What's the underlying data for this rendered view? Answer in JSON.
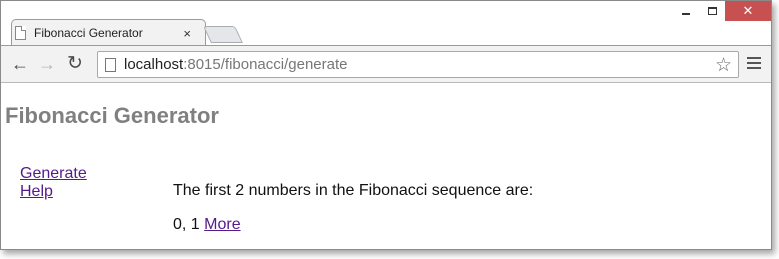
{
  "browser": {
    "tab_title": "Fibonacci Generator",
    "tab_close": "×",
    "url_host": "localhost",
    "url_rest": ":8015/fibonacci/generate",
    "close_glyph": "✕"
  },
  "page": {
    "title": "Fibonacci Generator",
    "nav": {
      "generate": "Generate",
      "help": "Help"
    },
    "intro": "The first 2 numbers in the Fibonacci sequence are:",
    "numbers": "0, 1",
    "more_link": "More"
  },
  "icons": {
    "back": "arrow-left-icon",
    "forward": "arrow-right-icon",
    "reload": "reload-icon",
    "star": "star-icon",
    "menu": "hamburger-menu-icon"
  },
  "colors": {
    "title": "#808080",
    "link": "#551a8b",
    "close_button": "#c75050"
  }
}
